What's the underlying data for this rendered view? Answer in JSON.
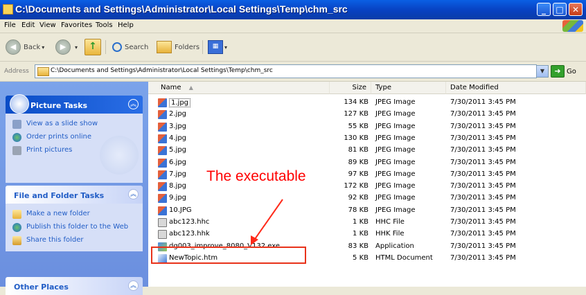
{
  "window": {
    "title": "C:\\Documents and Settings\\Administrator\\Local Settings\\Temp\\chm_src",
    "controls": [
      "_",
      "□",
      "✕"
    ]
  },
  "menu": [
    "File",
    "Edit",
    "View",
    "Favorites",
    "Tools",
    "Help"
  ],
  "toolbar": {
    "back_label": "Back",
    "search_label": "Search",
    "folders_label": "Folders"
  },
  "address": {
    "label": "Address",
    "path": "C:\\Documents and Settings\\Administrator\\Local Settings\\Temp\\chm_src",
    "go_label": "Go"
  },
  "taskpane": {
    "picture_tasks": {
      "title": "Picture Tasks",
      "items": [
        {
          "label": "View as a slide show",
          "icon": "slideshow-icon"
        },
        {
          "label": "Order prints online",
          "icon": "globe-icon"
        },
        {
          "label": "Print pictures",
          "icon": "printer-icon"
        }
      ]
    },
    "file_folder_tasks": {
      "title": "File and Folder Tasks",
      "items": [
        {
          "label": "Make a new folder",
          "icon": "new-folder-icon"
        },
        {
          "label": "Publish this folder to the Web",
          "icon": "publish-icon"
        },
        {
          "label": "Share this folder",
          "icon": "share-icon"
        }
      ]
    },
    "other_places": {
      "title": "Other Places"
    }
  },
  "columns": {
    "name": "Name",
    "size": "Size",
    "type": "Type",
    "date": "Date Modified"
  },
  "files": [
    {
      "name": "1.jpg",
      "size": "134 KB",
      "type": "JPEG Image",
      "date": "7/30/2011 3:45 PM",
      "icon": "jpg"
    },
    {
      "name": "2.jpg",
      "size": "127 KB",
      "type": "JPEG Image",
      "date": "7/30/2011 3:45 PM",
      "icon": "jpg"
    },
    {
      "name": "3.jpg",
      "size": "55 KB",
      "type": "JPEG Image",
      "date": "7/30/2011 3:45 PM",
      "icon": "jpg"
    },
    {
      "name": "4.jpg",
      "size": "130 KB",
      "type": "JPEG Image",
      "date": "7/30/2011 3:45 PM",
      "icon": "jpg"
    },
    {
      "name": "5.jpg",
      "size": "81 KB",
      "type": "JPEG Image",
      "date": "7/30/2011 3:45 PM",
      "icon": "jpg"
    },
    {
      "name": "6.jpg",
      "size": "89 KB",
      "type": "JPEG Image",
      "date": "7/30/2011 3:45 PM",
      "icon": "jpg"
    },
    {
      "name": "7.jpg",
      "size": "97 KB",
      "type": "JPEG Image",
      "date": "7/30/2011 3:45 PM",
      "icon": "jpg"
    },
    {
      "name": "8.jpg",
      "size": "172 KB",
      "type": "JPEG Image",
      "date": "7/30/2011 3:45 PM",
      "icon": "jpg"
    },
    {
      "name": "9.jpg",
      "size": "92 KB",
      "type": "JPEG Image",
      "date": "7/30/2011 3:45 PM",
      "icon": "jpg"
    },
    {
      "name": "10.JPG",
      "size": "78 KB",
      "type": "JPEG Image",
      "date": "7/30/2011 3:45 PM",
      "icon": "jpg"
    },
    {
      "name": "abc123.hhc",
      "size": "1 KB",
      "type": "HHC File",
      "date": "7/30/2011 3:45 PM",
      "icon": "hh"
    },
    {
      "name": "abc123.hhk",
      "size": "1 KB",
      "type": "HHK File",
      "date": "7/30/2011 3:45 PM",
      "icon": "hh"
    },
    {
      "name": "dg003_improve_8080_V132.exe",
      "size": "83 KB",
      "type": "Application",
      "date": "7/30/2011 3:45 PM",
      "icon": "exe"
    },
    {
      "name": "NewTopic.htm",
      "size": "5 KB",
      "type": "HTML Document",
      "date": "7/30/2011 3:45 PM",
      "icon": "htm"
    }
  ],
  "annotation": {
    "text": "The executable",
    "color": "#ff0000"
  }
}
